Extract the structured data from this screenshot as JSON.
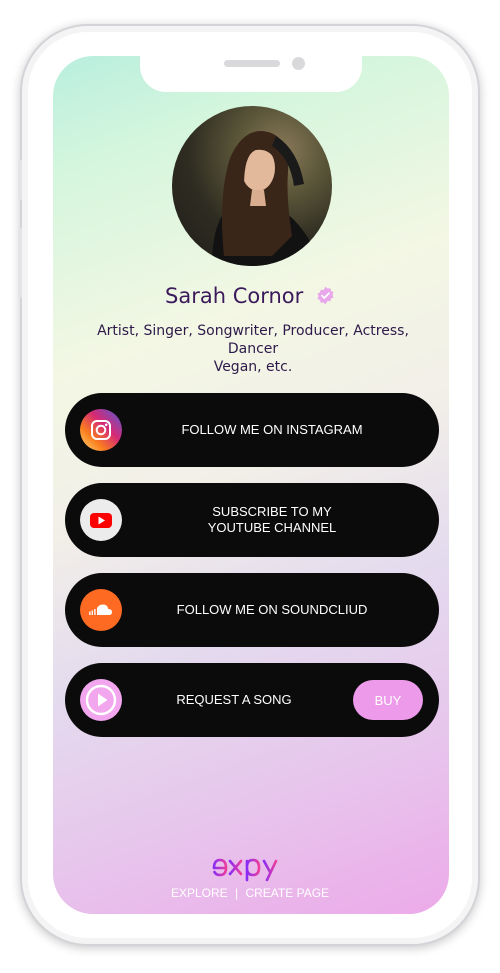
{
  "profile": {
    "name": "Sarah Cornor",
    "bio_line1": "Artist, Singer, Songwriter, Producer, Actress, Dancer",
    "bio_line2": "Vegan, etc."
  },
  "links": [
    {
      "label": "FOLLOW ME ON INSTAGRAM",
      "icon": "instagram-icon"
    },
    {
      "label_line1": "SUBSCRIBE TO MY",
      "label_line2": "YOUTUBE CHANNEL",
      "icon": "youtube-icon"
    },
    {
      "label": "FOLLOW ME ON SOUNDCLIUD",
      "icon": "soundcloud-icon"
    },
    {
      "label": "REQUEST A SONG",
      "icon": "play-icon",
      "action": "BUY"
    }
  ],
  "footer": {
    "brand": "expy",
    "explore": "EXPLORE",
    "separator": "|",
    "create": "CREATE PAGE"
  },
  "colors": {
    "name_text": "#3b1a5b",
    "verified_badge": "#e8a7ea",
    "button_bg": "#0b0b0b",
    "buy_bg": "#ec9ae9",
    "brand_gradient": [
      "#8b2cf5",
      "#ec3c9c"
    ]
  }
}
